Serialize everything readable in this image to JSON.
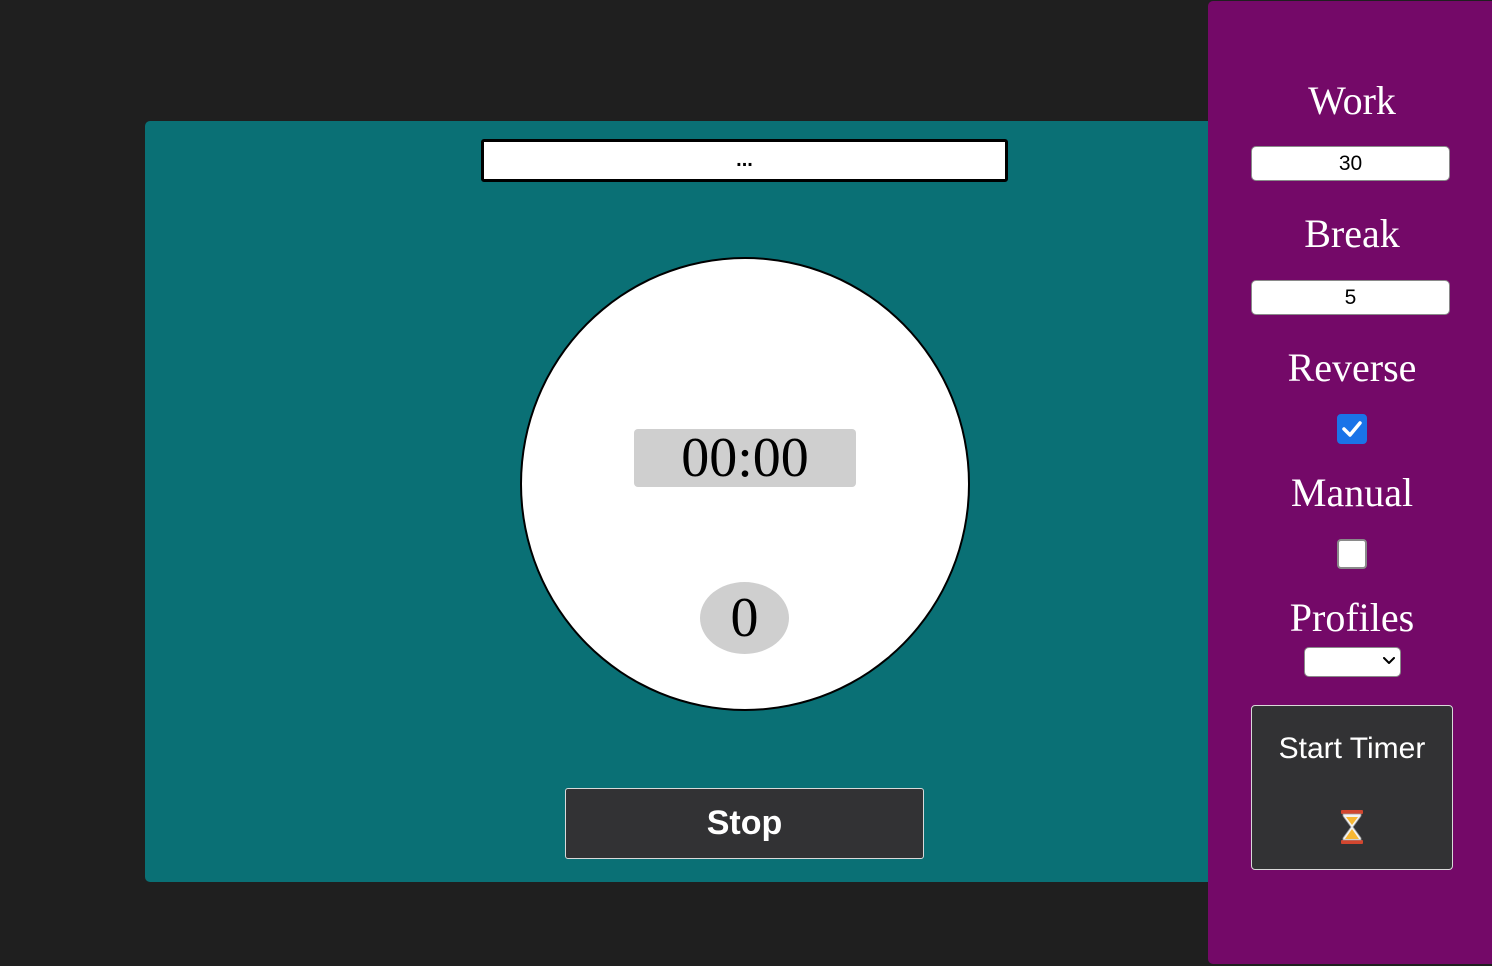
{
  "main": {
    "task_value": "...",
    "time": "00:00",
    "round": "0",
    "stop_label": "Stop"
  },
  "sidebar": {
    "work_label": "Work",
    "work_value": "30",
    "break_label": "Break",
    "break_value": "5",
    "reverse_label": "Reverse",
    "reverse_checked": true,
    "manual_label": "Manual",
    "manual_checked": false,
    "profiles_label": "Profiles",
    "profiles_selected": "",
    "start_label": "Start Timer",
    "start_icon": "hourglass-icon"
  },
  "colors": {
    "page_background": "#1f1f1f",
    "main_panel": "#0a7075",
    "sidebar": "#740968",
    "button": "#323234",
    "checkbox_accent": "#1a73e8",
    "display_background": "#cfcfcf"
  }
}
